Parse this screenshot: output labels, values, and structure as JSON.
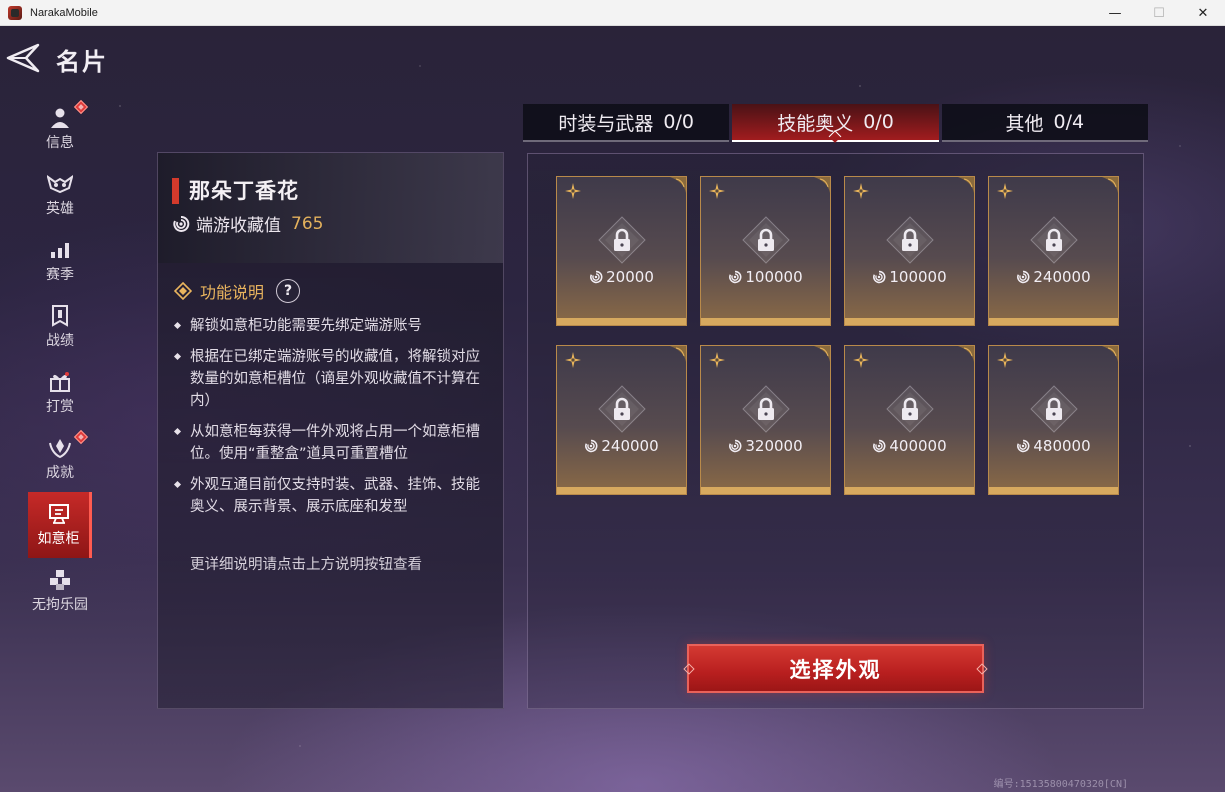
{
  "window": {
    "title": "NarakaMobile",
    "minimize": "—",
    "maximize": "☐",
    "close": "✕"
  },
  "header": {
    "back_icon": "back-arrow-icon",
    "title": "名片"
  },
  "sidebar": {
    "items": [
      {
        "label": "信息",
        "icon": "person-icon",
        "badge": true,
        "active": false
      },
      {
        "label": "英雄",
        "icon": "hero-mask-icon",
        "badge": false,
        "active": false
      },
      {
        "label": "赛季",
        "icon": "bar-chart-icon",
        "badge": false,
        "active": false
      },
      {
        "label": "战绩",
        "icon": "banner-icon",
        "badge": false,
        "active": false
      },
      {
        "label": "打赏",
        "icon": "gift-icon",
        "badge": false,
        "active": false
      },
      {
        "label": "成就",
        "icon": "achievement-icon",
        "badge": true,
        "active": false
      },
      {
        "label": "如意柜",
        "icon": "cabinet-icon",
        "badge": false,
        "active": true
      },
      {
        "label": "无拘乐园",
        "icon": "cubes-icon",
        "badge": false,
        "active": false
      }
    ]
  },
  "info": {
    "player_name": "那朵丁香花",
    "collection_label": "端游收藏值",
    "collection_value": "765",
    "function_title": "功能说明",
    "help_label": "?",
    "descriptions": [
      "解锁如意柜功能需要先绑定端游账号",
      "根据在已绑定端游账号的收藏值，将解锁对应数量的如意柜槽位（谪星外观收藏值不计算在内）",
      "从如意柜每获得一件外观将占用一个如意柜槽位。使用“重整盒”道具可重置槽位",
      "外观互通目前仅支持时装、武器、挂饰、技能奥义、展示背景、展示底座和发型"
    ],
    "more_note": "更详细说明请点击上方说明按钮查看"
  },
  "tabs": [
    {
      "label": "时装与武器",
      "count": "0/0",
      "active": false
    },
    {
      "label": "技能奥义",
      "count": "0/0",
      "active": true
    },
    {
      "label": "其他",
      "count": "0/4",
      "active": false
    }
  ],
  "slots": [
    {
      "requirement": "20000",
      "locked": true
    },
    {
      "requirement": "100000",
      "locked": true
    },
    {
      "requirement": "100000",
      "locked": true
    },
    {
      "requirement": "240000",
      "locked": true
    },
    {
      "requirement": "240000",
      "locked": true
    },
    {
      "requirement": "320000",
      "locked": true
    },
    {
      "requirement": "400000",
      "locked": true
    },
    {
      "requirement": "480000",
      "locked": true
    }
  ],
  "select_button": "选择外观",
  "footer_id": "编号:15135800470320[CN]",
  "colors": {
    "accent_red": "#c62a28",
    "gold": "#e3b15c",
    "slot_border": "#b98a4a"
  }
}
